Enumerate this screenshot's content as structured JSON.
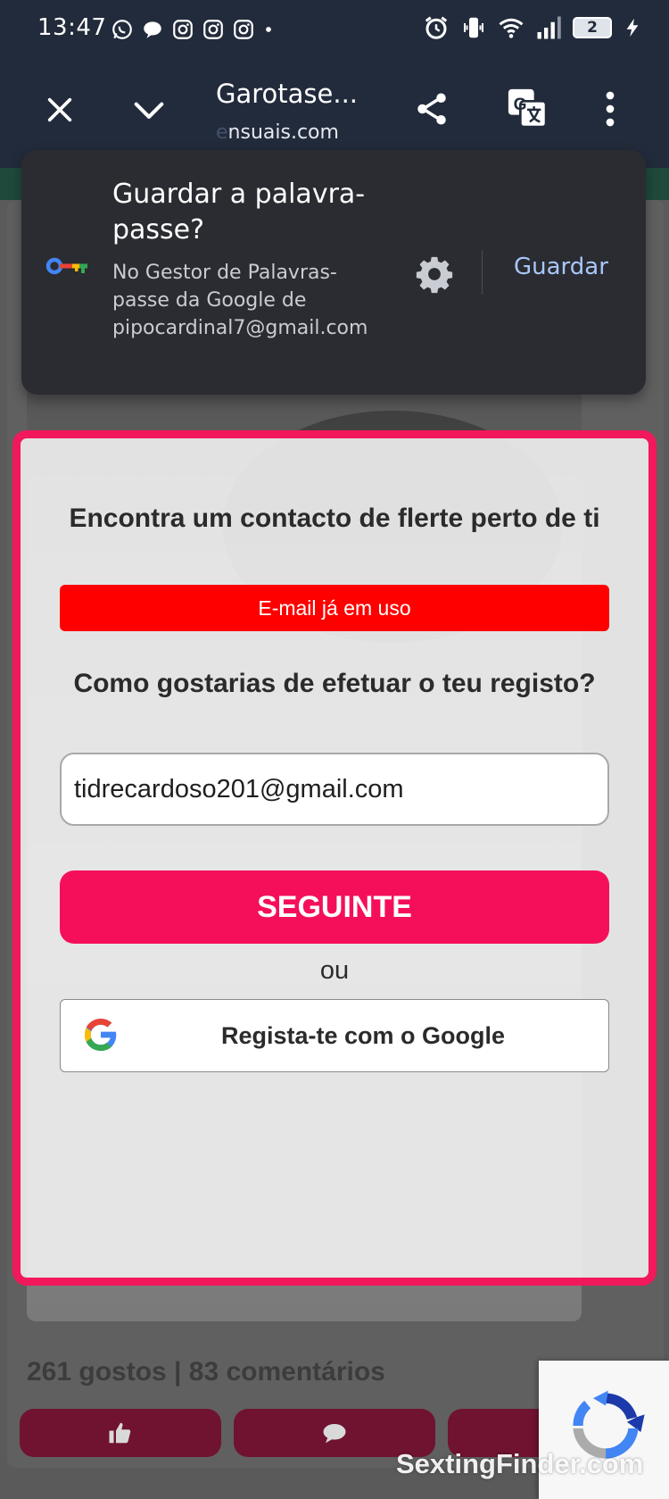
{
  "status_bar": {
    "time": "13:47",
    "battery_level": "2",
    "notification_icons": [
      "whatsapp-icon",
      "chat-bubble-icon",
      "instagram-icon",
      "instagram-icon",
      "instagram-icon",
      "dot-icon"
    ],
    "system_icons": [
      "alarm-icon",
      "vibrate-icon",
      "wifi-icon",
      "signal-icon",
      "battery-icon",
      "charging-icon"
    ]
  },
  "toolbar": {
    "title": "Garotase...",
    "url_faded": "e",
    "url": "nsuais.com"
  },
  "password_prompt": {
    "title": "Guardar a palavra-passe?",
    "description": "No Gestor de Palavras-passe da Google de pipocardinal7@gmail.com",
    "save_label": "Guardar"
  },
  "modal": {
    "heading": "Encontra um contacto de flerte perto de ti",
    "error": "E-mail já em uso",
    "question": "Como gostarias de efetuar o teu registo?",
    "email_value": "tidrecardoso201@gmail.com",
    "next_label": "SEGUINTE",
    "or_label": "ou",
    "google_label": "Regista-te com o Google"
  },
  "post": {
    "stats": "261 gostos | 83 comentários"
  },
  "watermark": "SextingFinder.com",
  "colors": {
    "system_bar": "#222b3b",
    "prompt_bg": "#2a2c31",
    "prompt_action": "#a8c7fa",
    "accent_pink": "#f50f5a",
    "error_red": "#ff0000",
    "action_button": "#6f1330"
  }
}
